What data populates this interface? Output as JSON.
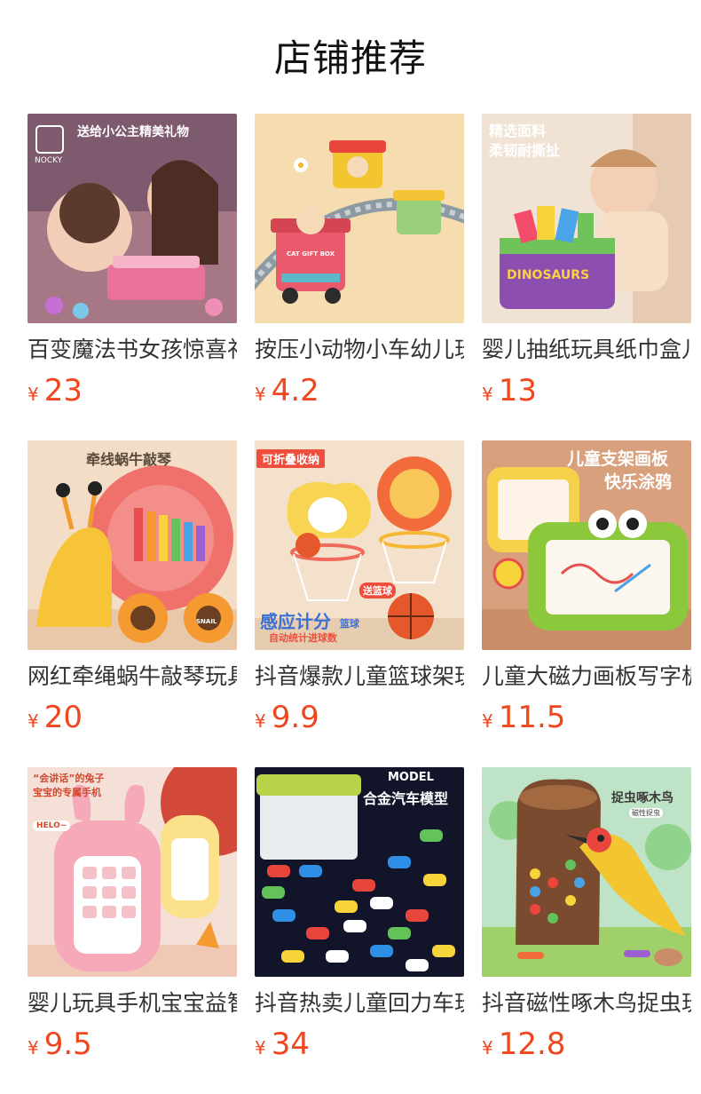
{
  "page": {
    "title": "店铺推荐"
  },
  "products": [
    {
      "name": "百变魔法书女孩惊喜礼物",
      "currency": "¥",
      "price": "23",
      "image_texts": [
        "送给小公主精美礼物",
        "NOCKY"
      ],
      "image_colors": [
        "#7d5a6e",
        "#e9b4c9"
      ]
    },
    {
      "name": "按压小动物小车幼儿玩具",
      "currency": "¥",
      "price": "4.2",
      "image_texts": [
        "CAT GIFT BOX"
      ],
      "image_colors": [
        "#f5ddb0",
        "#e95a6c"
      ]
    },
    {
      "name": "婴儿抽纸玩具纸巾盒儿童",
      "currency": "¥",
      "price": "13",
      "image_texts": [
        "精选面料",
        "柔韧耐撕扯",
        "DINOSAURS"
      ],
      "image_colors": [
        "#f1e3d3",
        "#8c4fb0"
      ]
    },
    {
      "name": "网红牵绳蜗牛敲琴玩具",
      "currency": "¥",
      "price": "20",
      "image_texts": [
        "牵线蜗牛敲琴",
        "SNAIL"
      ],
      "image_colors": [
        "#f3ddc7",
        "#f0706c"
      ]
    },
    {
      "name": "抖音爆款儿童篮球架玩具",
      "currency": "¥",
      "price": "9.9",
      "image_texts": [
        "可折叠收纳",
        "感应计分",
        "篮球",
        "自动统计进球数",
        "送篮球"
      ],
      "image_colors": [
        "#f3e1cc",
        "#f26b3a"
      ]
    },
    {
      "name": "儿童大磁力画板写字板",
      "currency": "¥",
      "price": "11.5",
      "image_texts": [
        "儿童支架画板",
        "快乐涂鸦"
      ],
      "image_colors": [
        "#d8a07c",
        "#8cc83c"
      ]
    },
    {
      "name": "婴儿玩具手机宝宝益智",
      "currency": "¥",
      "price": "9.5",
      "image_texts": [
        "“会讲话”的兔子",
        "宝宝的专属手机",
        "HELO~"
      ],
      "image_colors": [
        "#f4e0d6",
        "#f6a9b8"
      ]
    },
    {
      "name": "抖音热卖儿童回力车玩具",
      "currency": "¥",
      "price": "34",
      "image_texts": [
        "MODEL",
        "合金汽车模型"
      ],
      "image_colors": [
        "#12152a",
        "#b7d34a"
      ]
    },
    {
      "name": "抖音磁性啄木鸟捉虫玩具",
      "currency": "¥",
      "price": "12.8",
      "image_texts": [
        "捉虫啄木鸟",
        "磁性捉虫"
      ],
      "image_colors": [
        "#bfe3c6",
        "#7a4b2e"
      ]
    }
  ]
}
